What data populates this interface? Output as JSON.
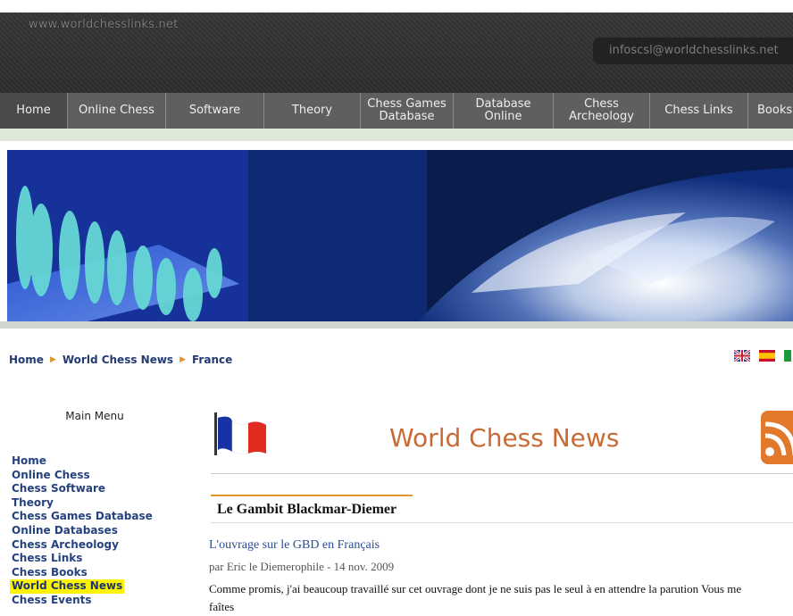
{
  "header": {
    "site_url": "www.worldchesslinks.net",
    "email": "infoscsl@worldchesslinks.net"
  },
  "nav": {
    "items": [
      {
        "label": "Home",
        "active": true
      },
      {
        "label": "Online Chess"
      },
      {
        "label": "Software"
      },
      {
        "label": "Theory"
      },
      {
        "label": "Chess Games\nDatabase"
      },
      {
        "label": "Database\nOnline"
      },
      {
        "label": "Chess\nArcheology"
      },
      {
        "label": "Chess Links"
      },
      {
        "label": "Books"
      }
    ]
  },
  "breadcrumb": {
    "items": [
      "Home",
      "World Chess News",
      "France"
    ],
    "separator_icon": "triangle-right-icon"
  },
  "language_flags": [
    "uk-flag-icon",
    "spain-flag-icon",
    "italy-flag-icon"
  ],
  "sidebar": {
    "title": "Main Menu",
    "items": [
      "Home",
      "Online Chess",
      "Chess Software",
      "Theory",
      "Chess Games Database",
      "Online Databases",
      "Chess Archeology",
      "Chess Links",
      "Chess Books",
      "World Chess News",
      "Chess Events"
    ],
    "current": "World Chess News"
  },
  "main": {
    "heading": "World Chess News",
    "heading_icon": "france-flag-icon",
    "rss_icon": "rss-icon",
    "article": {
      "title": "Le Gambit Blackmar-Diemer",
      "subtitle": "L'ouvrage sur le GBD en Français",
      "meta": "par Eric le Diemerophile - 14 nov. 2009",
      "body": "Comme promis, j'ai beaucoup travaillé sur cet ouvrage dont je ne suis pas le seul à en attendre la parution Vous me faîtes"
    }
  },
  "colors": {
    "nav_bg": "#5f5f5f",
    "link": "#26427e",
    "accent": "#e0962a",
    "heading": "#c96a35",
    "highlight": "#fdf200"
  }
}
